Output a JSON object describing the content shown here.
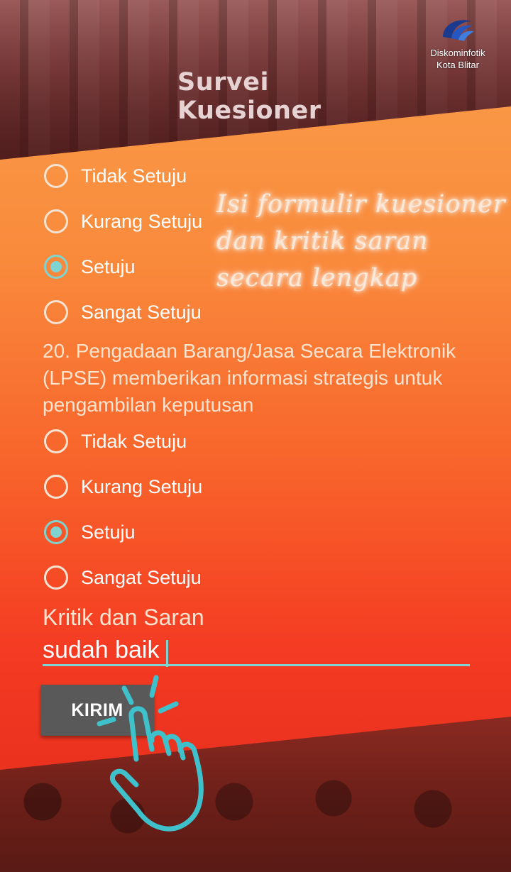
{
  "header": {
    "title": "Survei Kuesioner",
    "logo_line1": "Diskominfotik",
    "logo_line2": "Kota Blitar"
  },
  "overlay_hint": {
    "line1": "Isi formulir kuesioner",
    "line2": "dan kritik saran",
    "line3": "secara lengkap"
  },
  "question19_options": [
    {
      "label": "Tidak Setuju",
      "checked": false
    },
    {
      "label": "Kurang Setuju",
      "checked": false
    },
    {
      "label": "Setuju",
      "checked": true
    },
    {
      "label": "Sangat Setuju",
      "checked": false
    }
  ],
  "question20": {
    "text": "20. Pengadaan Barang/Jasa Secara Elektronik (LPSE) memberikan informasi strategis untuk pengambilan keputusan",
    "options": [
      {
        "label": "Tidak Setuju",
        "checked": false
      },
      {
        "label": "Kurang Setuju",
        "checked": false
      },
      {
        "label": "Setuju",
        "checked": true
      },
      {
        "label": "Sangat Setuju",
        "checked": false
      }
    ]
  },
  "feedback": {
    "label": "Kritik dan Saran",
    "value": "sudah baik"
  },
  "submit_label": "KIRIM",
  "colors": {
    "accent": "#7fd3d0",
    "button": "#595959",
    "gradient_top": "#f9a04c",
    "gradient_bottom": "#e02a1c"
  }
}
